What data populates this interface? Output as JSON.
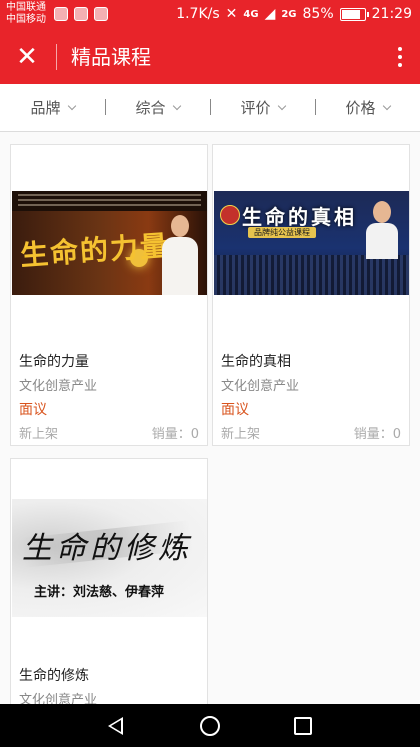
{
  "status_bar": {
    "carrier1": "中国联通",
    "carrier2": "中国移动",
    "net_speed": "1.7K/s",
    "net1": "4G",
    "net2": "2G",
    "battery": "85%",
    "battery_level": 0.85,
    "time": "21:29"
  },
  "app_bar": {
    "title": "精品课程"
  },
  "filters": [
    "品牌",
    "综合",
    "评价",
    "价格"
  ],
  "courses": [
    {
      "name": "生命的力量",
      "category": "文化创意产业",
      "price": "面议",
      "tag": "新上架",
      "sales": "销量：0",
      "banner_title": "生命的力量"
    },
    {
      "name": "生命的真相",
      "category": "文化创意产业",
      "price": "面议",
      "tag": "新上架",
      "sales": "销量：0",
      "banner_title": "生命的真相",
      "banner_sub": "品牌纯公益课程"
    },
    {
      "name": "生命的修炼",
      "category": "文化创意产业",
      "banner_title": "生命的修炼",
      "banner_sub": "主讲：刘法慈、伊春萍"
    }
  ]
}
